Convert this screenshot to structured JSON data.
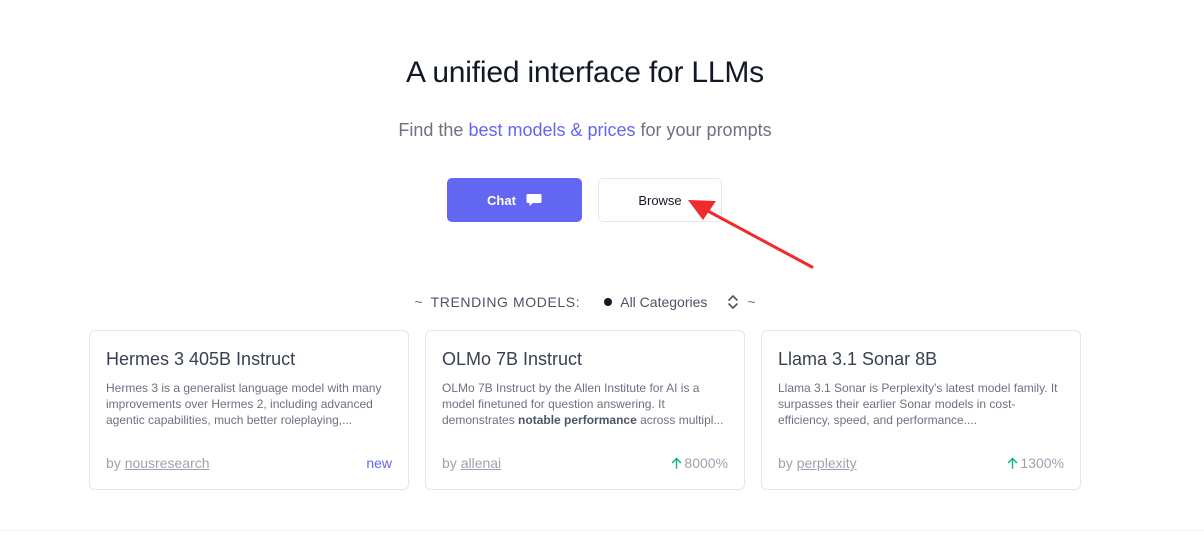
{
  "hero": {
    "title": "A unified interface for LLMs",
    "subtitle_prefix": "Find the ",
    "subtitle_highlight": "best models & prices",
    "subtitle_suffix": " for your prompts"
  },
  "cta": {
    "chat_label": "Chat",
    "browse_label": "Browse"
  },
  "trending": {
    "tilde_left": "~",
    "label": "TRENDING MODELS:",
    "category": "All Categories",
    "tilde_right": "~"
  },
  "models": [
    {
      "name": "Hermes 3 405B Instruct",
      "description": "Hermes 3 is a generalist language model with many improvements over Hermes 2, including advanced agentic capabilities, much better roleplaying,...",
      "by": "by ",
      "author": "nousresearch",
      "badge": "new"
    },
    {
      "name": "OLMo 7B Instruct",
      "description_before": "OLMo 7B Instruct by the Allen Institute for AI is a model finetuned for question answering. It demonstrates ",
      "description_bold": "notable performance",
      "description_after": " across multipl...",
      "by": "by ",
      "author": "allenai",
      "badge": "8000%"
    },
    {
      "name": "Llama 3.1 Sonar 8B",
      "description": "Llama 3.1 Sonar is Perplexity's latest model family. It surpasses their earlier Sonar models in cost-efficiency, speed, and performance....",
      "by": "by ",
      "author": "perplexity",
      "badge": "1300%"
    }
  ],
  "icons": {
    "chat": "chat-bubble-icon",
    "sort": "sort-updown-icon",
    "growth": "arrow-up-icon",
    "annotation": "red-arrow-annotation"
  },
  "colors": {
    "accent": "#6366f1",
    "growth": "#10b981",
    "annotation": "#ef2b2b"
  }
}
